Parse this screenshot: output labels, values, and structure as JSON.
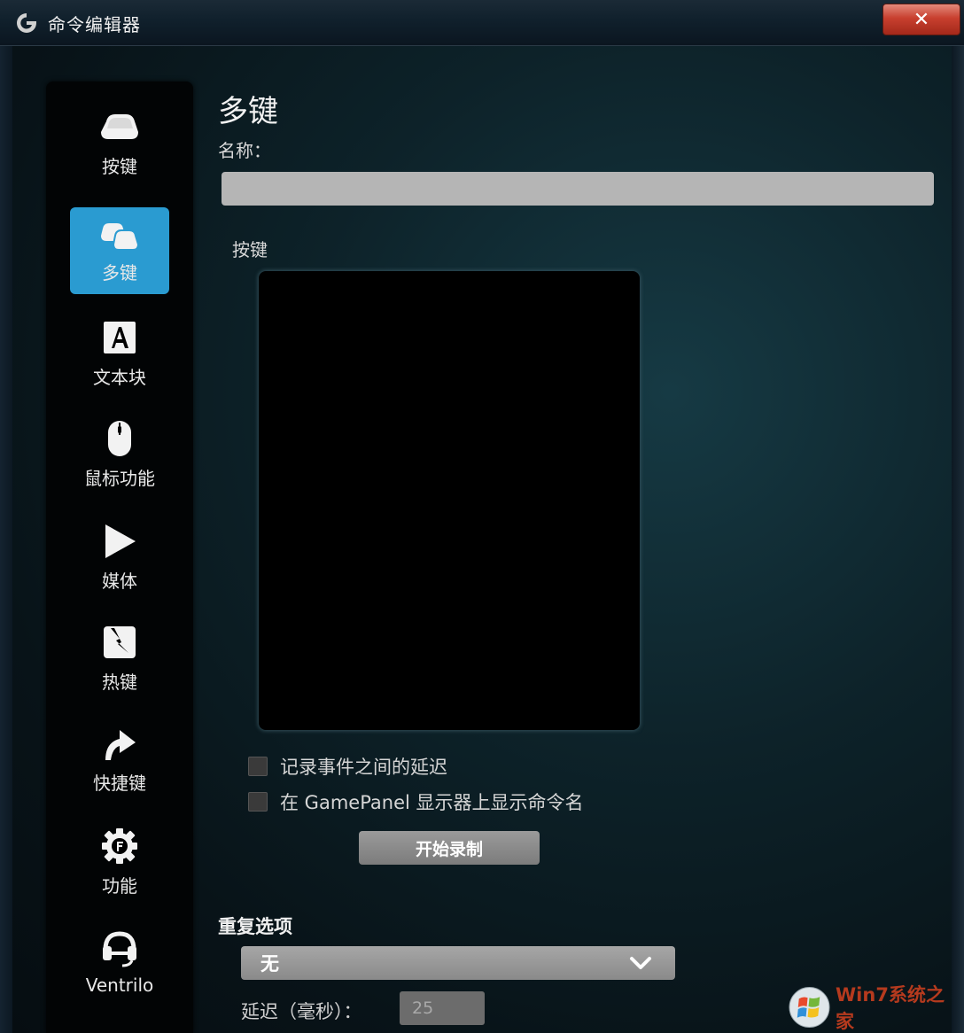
{
  "window": {
    "title": "命令编辑器",
    "close_label": "✕"
  },
  "sidebar": {
    "items": [
      {
        "label": "按键",
        "icon": "key-icon",
        "active": false
      },
      {
        "label": "多键",
        "icon": "multi-key-icon",
        "active": true
      },
      {
        "label": "文本块",
        "icon": "text-block-icon",
        "active": false
      },
      {
        "label": "鼠标功能",
        "icon": "mouse-icon",
        "active": false
      },
      {
        "label": "媒体",
        "icon": "play-icon",
        "active": false
      },
      {
        "label": "热键",
        "icon": "hotkey-icon",
        "active": false
      },
      {
        "label": "快捷键",
        "icon": "shortcut-arrow-icon",
        "active": false
      },
      {
        "label": "功能",
        "icon": "function-gear-icon",
        "active": false
      },
      {
        "label": "Ventrilo",
        "icon": "headset-icon",
        "active": false
      }
    ]
  },
  "main": {
    "heading": "多键",
    "name_label": "名称：",
    "name_value": "",
    "keys_label": "按键",
    "checkbox_delays": "记录事件之间的延迟",
    "checkbox_gamepanel": "在 GamePanel 显示器上显示命令名",
    "record_button": "开始录制",
    "repeat_label": "重复选项",
    "repeat_value": "无",
    "delay_label": "延迟（毫秒）：",
    "delay_value": "25"
  },
  "watermark": {
    "text": "Win7系统之家"
  },
  "colors": {
    "accent": "#2a9bd1",
    "close": "#c8402f"
  }
}
